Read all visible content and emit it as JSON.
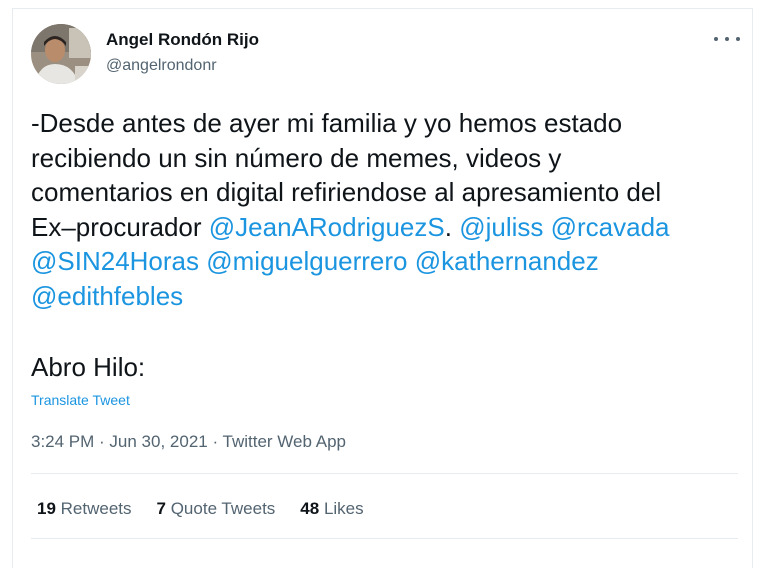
{
  "author": {
    "name": "Angel Rondón Rijo",
    "handle": "@angelrondonr"
  },
  "tweet": {
    "lines": [
      [
        {
          "text": "-Desde antes de ayer mi familia y yo hemos estado",
          "mention": false
        }
      ],
      [
        {
          "text": "recibiendo un sin número de memes, videos y",
          "mention": false
        }
      ],
      [
        {
          "text": "comentarios en digital refiriendose al apresamiento del",
          "mention": false
        }
      ],
      [
        {
          "text": "Ex–procurador ",
          "mention": false
        },
        {
          "text": "@JeanARodriguezS",
          "mention": true
        },
        {
          "text": ". ",
          "mention": false
        },
        {
          "text": "@juliss",
          "mention": true
        },
        {
          "text": " ",
          "mention": false
        },
        {
          "text": "@rcavada",
          "mention": true
        }
      ],
      [
        {
          "text": "@SIN24Horas",
          "mention": true
        },
        {
          "text": "  ",
          "mention": false
        },
        {
          "text": "@miguelguerrero",
          "mention": true
        },
        {
          "text": " ",
          "mention": false
        },
        {
          "text": "@kathernandez",
          "mention": true
        }
      ],
      [
        {
          "text": "@edithfebles",
          "mention": true
        }
      ]
    ],
    "closing": "Abro Hilo:",
    "translate_label": "Translate Tweet",
    "timestamp": "3:24 PM · Jun 30, 2021 · Twitter Web App"
  },
  "stats": [
    {
      "count": "19",
      "label": " Retweets"
    },
    {
      "count": "7",
      "label": " Quote Tweets"
    },
    {
      "count": "48",
      "label": " Likes"
    }
  ],
  "colors": {
    "mention": "#1b95e0",
    "text": "#0f1419",
    "secondary": "#536471",
    "divider": "#e6ecf0"
  }
}
